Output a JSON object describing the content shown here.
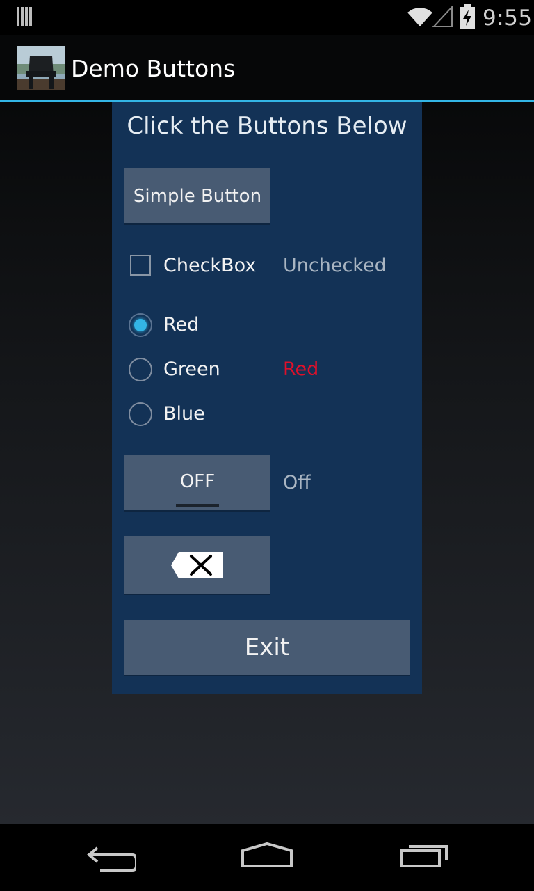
{
  "status_bar": {
    "time": "9:55",
    "icons": [
      "notification-icon",
      "wifi-icon",
      "signal-icon",
      "battery-charging-icon"
    ]
  },
  "action_bar": {
    "title": "Demo Buttons",
    "logo": "chair-photo-icon"
  },
  "panel": {
    "title": "Click the Buttons Below",
    "simple_button": "Simple Button",
    "checkbox": {
      "label": "CheckBox",
      "checked": false,
      "status": "Unchecked"
    },
    "radio_group": {
      "options": [
        "Red",
        "Green",
        "Blue"
      ],
      "selected": "Red",
      "status": "Red",
      "status_color": "#e0102a"
    },
    "toggle": {
      "label": "OFF",
      "status": "Off"
    },
    "image_button_icon": "delete-backspace-icon",
    "exit_button": "Exit"
  },
  "nav_bar": {
    "icons": [
      "back-icon",
      "home-icon",
      "recent-apps-icon"
    ]
  },
  "colors": {
    "accent": "#33b5e5",
    "panel": "#133256",
    "button": "#485b73"
  }
}
